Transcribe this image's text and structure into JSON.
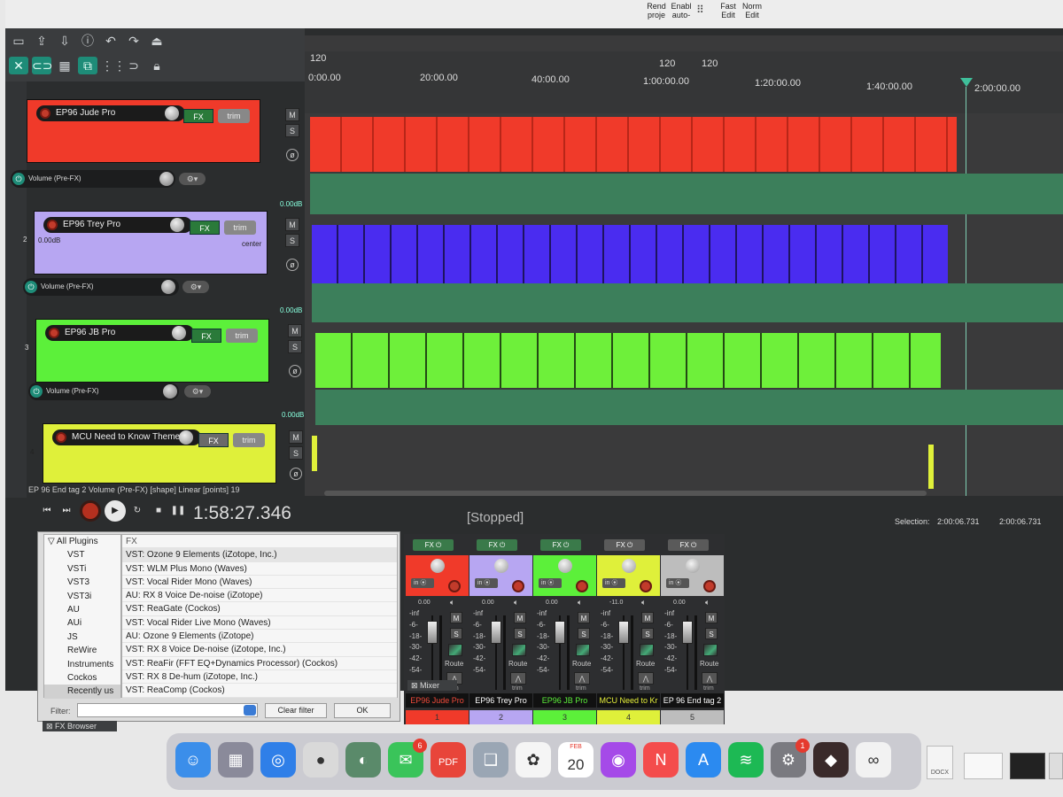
{
  "menu": {
    "items": [
      "Rend proje",
      "Enabl auto-",
      "Fast Edit",
      "Norm Edit"
    ]
  },
  "toolbar": {
    "icons": [
      "new-file-icon",
      "upload-icon",
      "download-icon",
      "info-icon",
      "undo-icon",
      "redo-icon",
      "metronome-icon",
      "ripple-icon",
      "link-icon",
      "grid-icon",
      "group-icon",
      "snap-icon",
      "loop-icon",
      "lock-icon"
    ]
  },
  "tracks": [
    {
      "num": "",
      "name": "EP96 Jude Pro",
      "color": "#f03a2a",
      "envelope": "Volume (Pre-FX)",
      "db": "0.00dB",
      "vol": "",
      "pan": ""
    },
    {
      "num": "2",
      "name": "EP96 Trey Pro",
      "color": "#b7a6f2",
      "envelope": "Volume (Pre-FX)",
      "db": "0.00dB",
      "vol": "0.00dB",
      "pan": "center"
    },
    {
      "num": "3",
      "name": "EP96 JB Pro",
      "color": "#5cf03a",
      "envelope": "Volume (Pre-FX)",
      "db": "0.00dB",
      "vol": "",
      "pan": ""
    },
    {
      "num": "4",
      "name": "MCU Need to Know Theme",
      "color": "#dff03a",
      "envelope": "",
      "db": "",
      "vol": "",
      "pan": ""
    }
  ],
  "track_buttons": {
    "fx": "FX",
    "trim": "trim",
    "mute": "M",
    "solo": "S",
    "phase": "ø"
  },
  "ruler": {
    "markers": [
      "120",
      "120",
      "120"
    ],
    "times": [
      "0:00.00",
      "20:00.00",
      "40:00.00",
      "1:00:00.00",
      "1:20:00.00",
      "1:40:00.00",
      "2:00:00.00"
    ]
  },
  "status": {
    "envelope_info": "EP 96 End tag 2 Volume (Pre-FX) [shape] Linear [points] 19"
  },
  "transport": {
    "time": "1:58:27.346",
    "state": "[Stopped]",
    "selection_label": "Selection:",
    "selection_start": "2:00:06.731",
    "selection_end": "2:00:06.731"
  },
  "fx_browser": {
    "title": "FX Browser",
    "search": "FX",
    "tree": [
      "All Plugins",
      "VST",
      "VSTi",
      "VST3",
      "VST3i",
      "AU",
      "AUi",
      "JS",
      "ReWire",
      "Instruments",
      "Cockos",
      "Recently us"
    ],
    "plugins": [
      "VST: Ozone 9 Elements (iZotope, Inc.)",
      "VST: WLM Plus Mono (Waves)",
      "VST: Vocal Rider Mono (Waves)",
      "AU: RX 8 Voice De-noise (iZotope)",
      "VST: ReaGate (Cockos)",
      "VST: Vocal Rider Live Mono (Waves)",
      "AU: Ozone 9 Elements (iZotope)",
      "VST: RX 8 Voice De-noise (iZotope, Inc.)",
      "VST: ReaFir (FFT EQ+Dynamics Processor) (Cockos)",
      "VST: RX 8 De-hum (iZotope, Inc.)",
      "VST: ReaComp (Cockos)"
    ],
    "filter_label": "Filter:",
    "filter_value": "",
    "clear_label": "Clear filter",
    "ok_label": "OK"
  },
  "mixer": {
    "title": "Mixer",
    "scale": [
      "-inf",
      "-6-",
      "-18-",
      "-30-",
      "-42-",
      "-54-"
    ],
    "route": "Route",
    "trim": "trim",
    "in": "in",
    "strips": [
      {
        "name": "EP96 Jude Pro",
        "num": "1",
        "color": "#f03a2a",
        "val": "0.00",
        "text_color": "#f04a3a"
      },
      {
        "name": "EP96 Trey Pro",
        "num": "2",
        "color": "#b7a6f2",
        "val": "0.00",
        "text_color": "#ffffff"
      },
      {
        "name": "EP96 JB Pro",
        "num": "3",
        "color": "#5cf03a",
        "val": "0.00",
        "text_color": "#5cf03a"
      },
      {
        "name": "MCU Need to Kr",
        "num": "4",
        "color": "#dff03a",
        "val": "-11.0",
        "text_color": "#e6f03a"
      },
      {
        "name": "EP 96 End tag 2",
        "num": "5",
        "color": "#bdbdbd",
        "val": "0.00",
        "text_color": "#ffffff"
      }
    ]
  },
  "dock": {
    "apps": [
      {
        "icon": "finder-icon",
        "glyph": "☺",
        "color": "#3b8eea",
        "badge": ""
      },
      {
        "icon": "launchpad-icon",
        "glyph": "▦",
        "color": "#8a8a9a",
        "badge": ""
      },
      {
        "icon": "safari-icon",
        "glyph": "◎",
        "color": "#2f7fe8",
        "badge": ""
      },
      {
        "icon": "chrome-icon",
        "glyph": "●",
        "color": "#d9d9d9",
        "badge": ""
      },
      {
        "icon": "reaper-icon",
        "glyph": "◐",
        "color": "#5a8a6a",
        "badge": ""
      },
      {
        "icon": "messages-icon",
        "glyph": "✉",
        "color": "#3ac45a",
        "badge": "6"
      },
      {
        "icon": "pdf-icon",
        "glyph": "PDF",
        "color": "#e8453a",
        "badge": ""
      },
      {
        "icon": "preview-icon",
        "glyph": "❑",
        "color": "#9aa6b4",
        "badge": ""
      },
      {
        "icon": "photos-icon",
        "glyph": "✿",
        "color": "#f5f5f5",
        "badge": ""
      },
      {
        "icon": "calendar-icon",
        "glyph": "20",
        "color": "#ffffff",
        "badge": ""
      },
      {
        "icon": "podcasts-icon",
        "glyph": "◉",
        "color": "#a54ae8",
        "badge": ""
      },
      {
        "icon": "news-icon",
        "glyph": "N",
        "color": "#f44c4c",
        "badge": ""
      },
      {
        "icon": "appstore-icon",
        "glyph": "A",
        "color": "#2b8af0",
        "badge": ""
      },
      {
        "icon": "spotify-icon",
        "glyph": "≋",
        "color": "#1db954",
        "badge": ""
      },
      {
        "icon": "settings-icon",
        "glyph": "⚙",
        "color": "#7a7a80",
        "badge": "1"
      },
      {
        "icon": "dice-icon",
        "glyph": "◆",
        "color": "#3a2a2a",
        "badge": ""
      },
      {
        "icon": "link-app-icon",
        "glyph": "∞",
        "color": "#f2f2f2",
        "badge": ""
      }
    ],
    "calendar_month": "FEB"
  },
  "right_dock": {
    "doc_label": "DOCX"
  }
}
